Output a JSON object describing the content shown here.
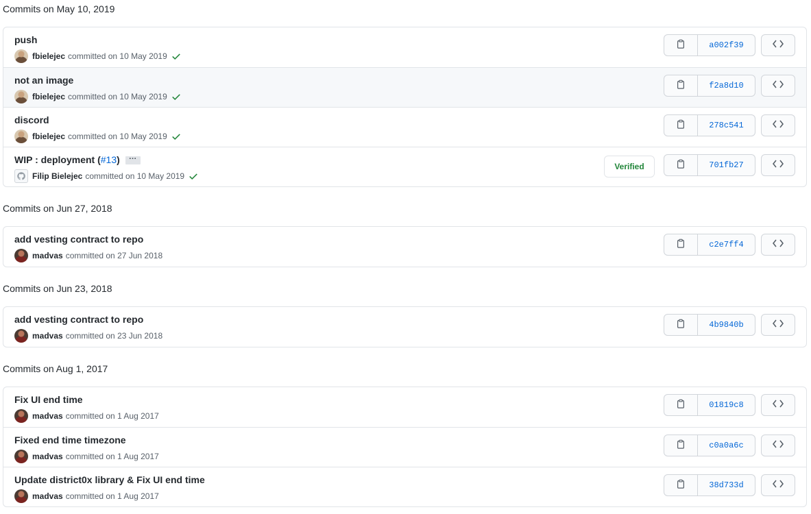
{
  "groups": [
    {
      "title": "Commits on May 10, 2019",
      "commits": [
        {
          "message": "push",
          "author": "fbielejec",
          "committed": "committed on 10 May 2019",
          "sha": "a002f39"
        },
        {
          "message": "not an image",
          "author": "fbielejec",
          "committed": "committed on 10 May 2019",
          "sha": "f2a8d10"
        },
        {
          "message": "discord",
          "author": "fbielejec",
          "committed": "committed on 10 May 2019",
          "sha": "278c541"
        },
        {
          "message": "WIP : deployment (",
          "pr": "#13",
          "message_end": ")",
          "ellipsis": "···",
          "author": "Filip Bielejec",
          "committed": "committed on 10 May 2019",
          "verified": "Verified",
          "sha": "701fb27"
        }
      ]
    },
    {
      "title": "Commits on Jun 27, 2018",
      "commits": [
        {
          "message": "add vesting contract to repo",
          "author": "madvas",
          "committed": "committed on 27 Jun 2018",
          "sha": "c2e7ff4"
        }
      ]
    },
    {
      "title": "Commits on Jun 23, 2018",
      "commits": [
        {
          "message": "add vesting contract to repo",
          "author": "madvas",
          "committed": "committed on 23 Jun 2018",
          "sha": "4b9840b"
        }
      ]
    },
    {
      "title": "Commits on Aug 1, 2017",
      "commits": [
        {
          "message": "Fix UI end time",
          "author": "madvas",
          "committed": "committed on 1 Aug 2017",
          "sha": "01819c8"
        },
        {
          "message": "Fixed end time timezone",
          "author": "madvas",
          "committed": "committed on 1 Aug 2017",
          "sha": "c0a0a6c"
        },
        {
          "message": "Update district0x library & Fix UI end time",
          "author": "madvas",
          "committed": "committed on 1 Aug 2017",
          "sha": "38d733d"
        }
      ]
    }
  ],
  "icons": {
    "copy": "clippy-icon",
    "browse": "code-icon",
    "status": "check-icon",
    "avatar_placeholder": "mark-github-icon"
  },
  "colors": {
    "link": "#0366d6",
    "success": "#22863a",
    "border": "#e1e4e8",
    "text": "#24292e",
    "muted": "#586069"
  }
}
